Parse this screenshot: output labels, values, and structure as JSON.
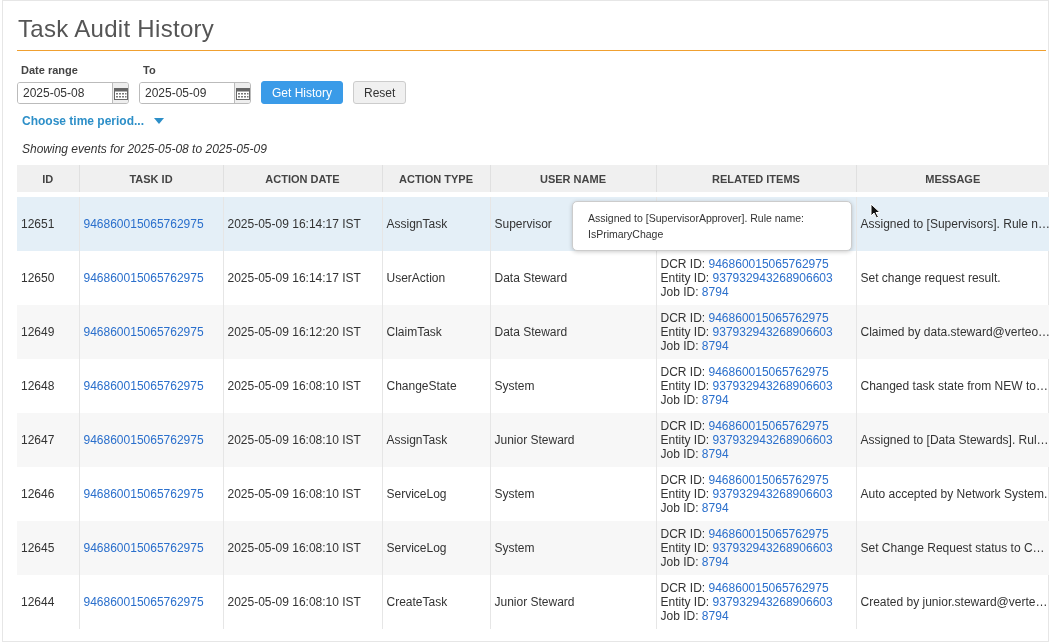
{
  "title": "Task Audit History",
  "filters": {
    "from_label": "Date range",
    "from_value": "2025-05-08",
    "to_label": "To",
    "to_value": "2025-05-09",
    "get_button": "Get History",
    "reset_button": "Reset",
    "period_link": "Choose time period...",
    "summary": "Showing events for 2025-05-08 to 2025-05-09"
  },
  "table": {
    "columns": [
      "ID",
      "TASK ID",
      "ACTION DATE",
      "ACTION TYPE",
      "USER NAME",
      "RELATED ITEMS",
      "MESSAGE"
    ],
    "rows": [
      {
        "id": "12651",
        "task_id": "946860015065762975",
        "action_date": "2025-05-09 16:14:17 IST",
        "action_type": "AssignTask",
        "user_name": "Supervisor",
        "message": "Assigned to [Supervisors]. Rule n…",
        "selected": true,
        "tooltip": "Assigned to [SupervisorApprover]. Rule name: IsPrimaryChage"
      },
      {
        "id": "12650",
        "task_id": "946860015065762975",
        "action_date": "2025-05-09 16:14:17 IST",
        "action_type": "UserAction",
        "user_name": "Data Steward",
        "related": [
          {
            "label": "DCR ID:",
            "value": "946860015065762975"
          },
          {
            "label": "Entity ID:",
            "value": "937932943268906603"
          },
          {
            "label": "Job ID:",
            "value": "8794"
          }
        ],
        "message": "Set change request result.",
        "selected": false
      },
      {
        "id": "12649",
        "task_id": "946860015065762975",
        "action_date": "2025-05-09 16:12:20 IST",
        "action_type": "ClaimTask",
        "user_name": "Data Steward",
        "related": [
          {
            "label": "DCR ID:",
            "value": "946860015065762975"
          },
          {
            "label": "Entity ID:",
            "value": "937932943268906603"
          },
          {
            "label": "Job ID:",
            "value": "8794"
          }
        ],
        "message": "Claimed by data.steward@verteo…",
        "selected": false
      },
      {
        "id": "12648",
        "task_id": "946860015065762975",
        "action_date": "2025-05-09 16:08:10 IST",
        "action_type": "ChangeState",
        "user_name": "System",
        "related": [
          {
            "label": "DCR ID:",
            "value": "946860015065762975"
          },
          {
            "label": "Entity ID:",
            "value": "937932943268906603"
          },
          {
            "label": "Job ID:",
            "value": "8794"
          }
        ],
        "message": "Changed task state from NEW to…",
        "selected": false
      },
      {
        "id": "12647",
        "task_id": "946860015065762975",
        "action_date": "2025-05-09 16:08:10 IST",
        "action_type": "AssignTask",
        "user_name": "Junior Steward",
        "related": [
          {
            "label": "DCR ID:",
            "value": "946860015065762975"
          },
          {
            "label": "Entity ID:",
            "value": "937932943268906603"
          },
          {
            "label": "Job ID:",
            "value": "8794"
          }
        ],
        "message": "Assigned to [Data Stewards]. Rul…",
        "selected": false
      },
      {
        "id": "12646",
        "task_id": "946860015065762975",
        "action_date": "2025-05-09 16:08:10 IST",
        "action_type": "ServiceLog",
        "user_name": "System",
        "related": [
          {
            "label": "DCR ID:",
            "value": "946860015065762975"
          },
          {
            "label": "Entity ID:",
            "value": "937932943268906603"
          },
          {
            "label": "Job ID:",
            "value": "8794"
          }
        ],
        "message": "Auto accepted by Network System.",
        "selected": false
      },
      {
        "id": "12645",
        "task_id": "946860015065762975",
        "action_date": "2025-05-09 16:08:10 IST",
        "action_type": "ServiceLog",
        "user_name": "System",
        "related": [
          {
            "label": "DCR ID:",
            "value": "946860015065762975"
          },
          {
            "label": "Entity ID:",
            "value": "937932943268906603"
          },
          {
            "label": "Job ID:",
            "value": "8794"
          }
        ],
        "message": "Set Change Request status to C…",
        "selected": false
      },
      {
        "id": "12644",
        "task_id": "946860015065762975",
        "action_date": "2025-05-09 16:08:10 IST",
        "action_type": "CreateTask",
        "user_name": "Junior Steward",
        "related": [
          {
            "label": "DCR ID:",
            "value": "946860015065762975"
          },
          {
            "label": "Entity ID:",
            "value": "937932943268906603"
          },
          {
            "label": "Job ID:",
            "value": "8794"
          }
        ],
        "message": "Created by junior.steward@verte…",
        "selected": false
      }
    ]
  }
}
